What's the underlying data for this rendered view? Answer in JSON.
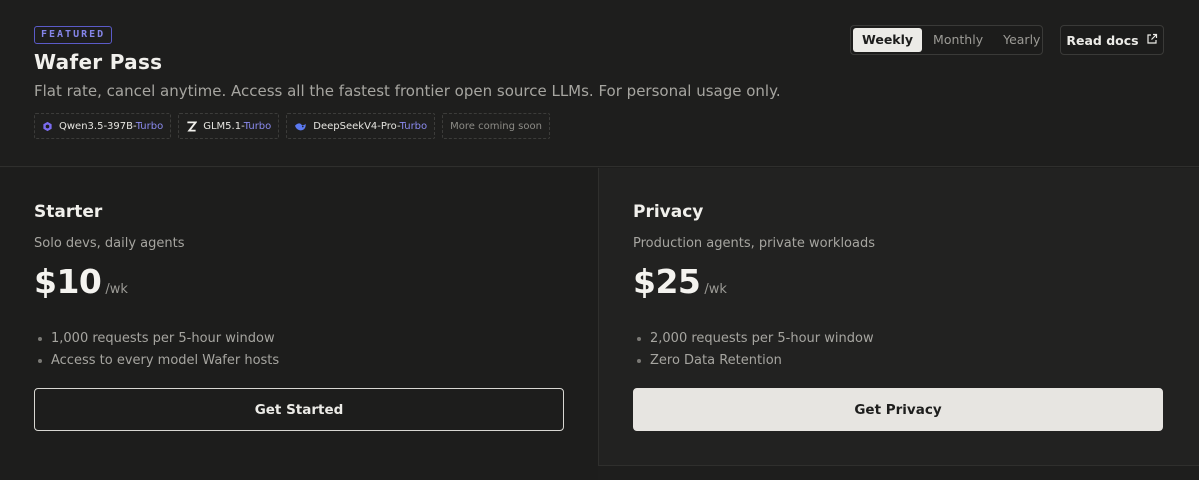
{
  "header": {
    "badge": "FEATURED",
    "title": "Wafer Pass",
    "subtitle": "Flat rate, cancel anytime. Access all the fastest frontier open source LLMs. For personal usage only.",
    "models": [
      {
        "name": "Qwen3.5-397B-",
        "suffix": "Turbo",
        "icon": "qwen-icon"
      },
      {
        "name": "GLM5.1-",
        "suffix": "Turbo",
        "icon": "zhipu-icon"
      },
      {
        "name": "DeepSeekV4-Pro-",
        "suffix": "Turbo",
        "icon": "deepseek-icon"
      }
    ],
    "more": "More coming soon"
  },
  "billing_toggle": {
    "options": [
      "Weekly",
      "Monthly",
      "Yearly"
    ],
    "selected": "Weekly"
  },
  "docs": {
    "label": "Read docs",
    "icon": "external-link-icon"
  },
  "plans": [
    {
      "name": "Starter",
      "description": "Solo devs, daily agents",
      "price": "$10",
      "period": "/wk",
      "features": [
        "1,000 requests per 5-hour window",
        "Access to every model Wafer hosts"
      ],
      "cta": "Get Started"
    },
    {
      "name": "Privacy",
      "description": "Production agents, private workloads",
      "price": "$25",
      "period": "/wk",
      "features": [
        "2,000 requests per 5-hour window",
        "Zero Data Retention"
      ],
      "cta": "Get Privacy"
    }
  ],
  "colors": {
    "background": "#1e1e1d",
    "accent": "#8a8aee",
    "button_filled": "#e7e5e1"
  }
}
